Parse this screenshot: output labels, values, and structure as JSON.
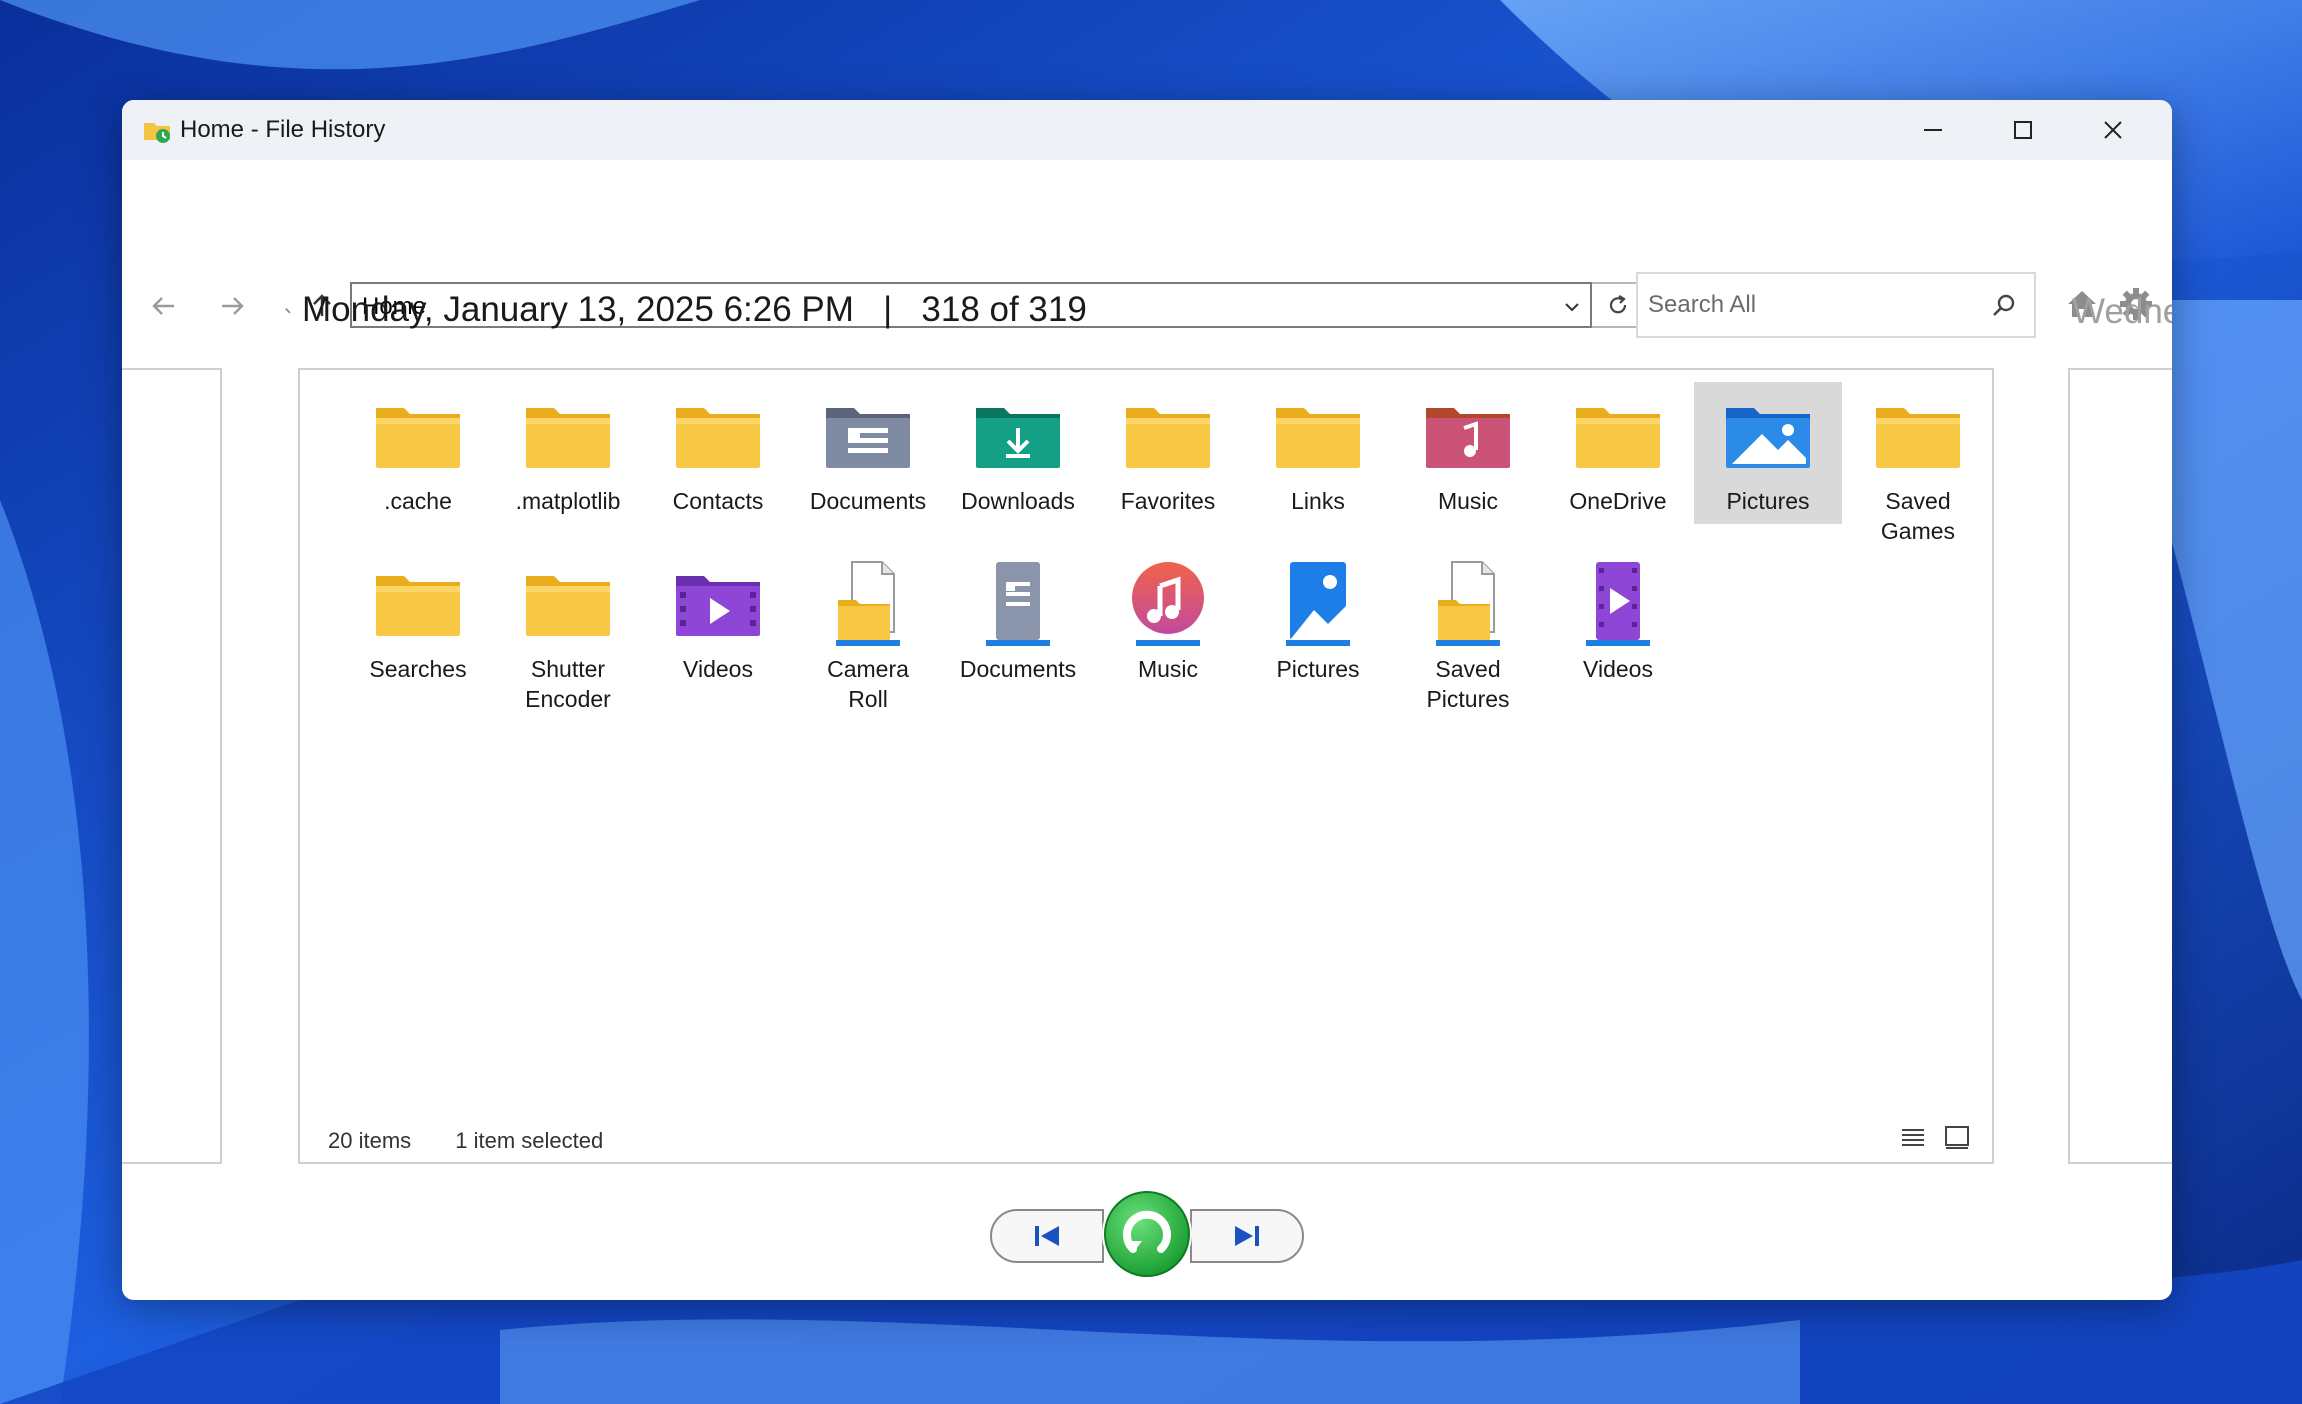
{
  "window": {
    "title": "Home - File History",
    "minimize_icon": "minimize-icon",
    "maximize_icon": "maximize-icon",
    "close_icon": "close-icon"
  },
  "toolbar": {
    "back_icon": "arrow-left-icon",
    "forward_icon": "arrow-right-icon",
    "recent_icon": "chevron-down-icon",
    "up_icon": "arrow-up-icon",
    "address_value": "Home",
    "refresh_icon": "refresh-icon",
    "search_placeholder": "Search All",
    "home_icon": "home-icon",
    "settings_icon": "gear-icon"
  },
  "snapshot": {
    "date": "Monday, January 13, 2025 6:26 PM",
    "separator": "|",
    "position": "318 of 319",
    "next_date": "Wedne"
  },
  "items": [
    {
      "label": ".cache",
      "icon": "folder"
    },
    {
      "label": ".matplotlib",
      "icon": "folder"
    },
    {
      "label": "Contacts",
      "icon": "folder"
    },
    {
      "label": "Documents",
      "icon": "documents-folder"
    },
    {
      "label": "Downloads",
      "icon": "downloads-folder"
    },
    {
      "label": "Favorites",
      "icon": "folder"
    },
    {
      "label": "Links",
      "icon": "folder"
    },
    {
      "label": "Music",
      "icon": "music-folder"
    },
    {
      "label": "OneDrive",
      "icon": "folder"
    },
    {
      "label": "Pictures",
      "icon": "pictures-folder",
      "selected": true
    },
    {
      "label": "Saved\nGames",
      "icon": "folder"
    },
    {
      "label": "Searches",
      "icon": "folder"
    },
    {
      "label": "Shutter\nEncoder",
      "icon": "folder"
    },
    {
      "label": "Videos",
      "icon": "videos-folder"
    },
    {
      "label": "Camera\nRoll",
      "icon": "camera-roll-library"
    },
    {
      "label": "Documents",
      "icon": "documents-library"
    },
    {
      "label": "Music",
      "icon": "music-library"
    },
    {
      "label": "Pictures",
      "icon": "pictures-library"
    },
    {
      "label": "Saved\nPictures",
      "icon": "saved-pictures-library"
    },
    {
      "label": "Videos",
      "icon": "videos-library"
    }
  ],
  "status": {
    "count": "20 items",
    "selection": "1 item selected",
    "details_view_icon": "details-view-icon",
    "large_icons_view_icon": "large-icons-view-icon"
  },
  "playback": {
    "previous_icon": "previous-version-icon",
    "restore_icon": "restore-icon",
    "next_icon": "next-version-icon"
  },
  "colors": {
    "folder_yellow": "#f8c844",
    "selection": "#d9d9d9",
    "restore_green": "#22b53a"
  }
}
